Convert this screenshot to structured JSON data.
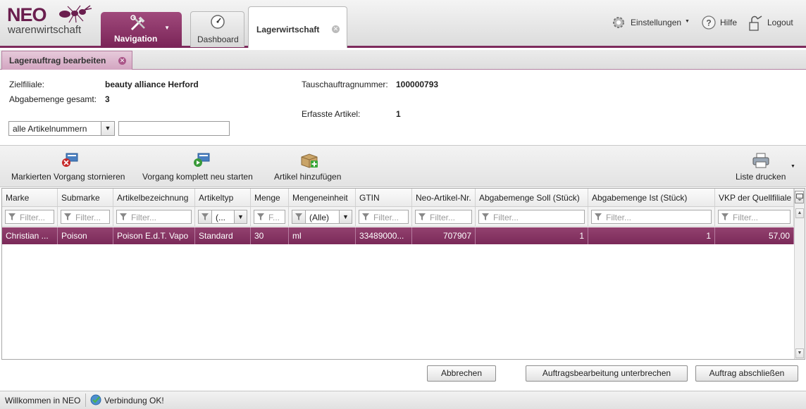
{
  "app": {
    "logo_main": "NEO",
    "logo_sub": "warenwirtschaft",
    "nav_label": "Navigation",
    "tabs": [
      {
        "label": "Dashboard"
      },
      {
        "label": "Lagerwirtschaft"
      }
    ],
    "header_links": {
      "settings": "Einstellungen",
      "help": "Hilfe",
      "logout": "Logout"
    }
  },
  "subtab": {
    "label": "Lagerauftrag bearbeiten"
  },
  "info": {
    "zielfiliale_label": "Zielfiliale:",
    "zielfiliale_value": "beauty alliance Herford",
    "abgabemenge_label": "Abgabemenge gesamt:",
    "abgabemenge_value": "3",
    "tauschauftrag_label": "Tauschauftragnummer:",
    "tauschauftrag_value": "100000793",
    "erfasste_label": "Erfasste Artikel:",
    "erfasste_value": "1"
  },
  "search": {
    "select_value": "alle Artikelnummern",
    "input_value": ""
  },
  "toolbar": {
    "cancel_label": "Markierten Vorgang stornieren",
    "restart_label": "Vorgang komplett neu starten",
    "add_label": "Artikel hinzufügen",
    "print_label": "Liste drucken"
  },
  "grid": {
    "headers": [
      "Marke",
      "Submarke",
      "Artikelbezeichnung",
      "Artikeltyp",
      "Menge",
      "Mengeneinheit",
      "GTIN",
      "Neo-Artikel-Nr.",
      "Abgabemenge Soll (Stück)",
      "Abgabemenge Ist (Stück)",
      "VKP der Quellfiliale"
    ],
    "filter_placeholder": "Filter...",
    "filter_short": "F...",
    "filter_artikeltyp": "(...",
    "filter_mengeneinheit": "(Alle)",
    "rows": [
      [
        "Christian ...",
        "Poison",
        "Poison E.d.T. Vapo",
        "Standard",
        "30",
        "ml",
        "33489000...",
        "707907",
        "1",
        "1",
        "57,00"
      ]
    ]
  },
  "buttons": {
    "abbrechen": "Abbrechen",
    "unterbrechen": "Auftragsbearbeitung unterbrechen",
    "abschliessen": "Auftrag abschließen"
  },
  "status": {
    "welcome": "Willkommen in NEO",
    "connection": "Verbindung OK!"
  },
  "colors": {
    "accent": "#7d2a5c",
    "selected_row": "#862f63"
  }
}
